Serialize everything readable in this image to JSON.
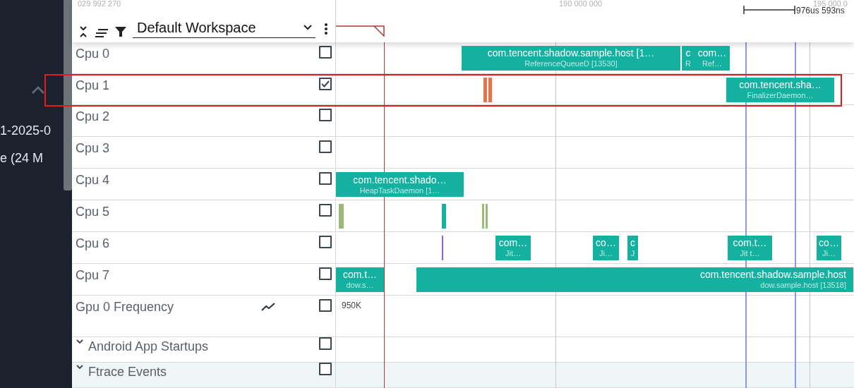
{
  "sidebar": {
    "texts": [
      "1-2025-0",
      "e (24 M"
    ]
  },
  "timeline_header": {
    "ticks": [
      "029 992 270",
      "190 000 000",
      "195 000 0"
    ],
    "span": "976us 593ns"
  },
  "toolbar": {
    "workspace": "Default Workspace"
  },
  "tracks": [
    {
      "name": "Cpu 0",
      "kind": "cpu",
      "checked": false,
      "slices": [
        {
          "kind": "slice",
          "title": "com.tencent.shadow.sample.host [1…",
          "subtitle": "ReferenceQueueD [13530]"
        },
        {
          "kind": "slice",
          "title": "c",
          "subtitle": "R"
        },
        {
          "kind": "slice",
          "title": "com…",
          "subtitle": "Ref…"
        }
      ]
    },
    {
      "name": "Cpu 1",
      "kind": "cpu",
      "checked": true,
      "highlighted": true,
      "slices": [
        {
          "kind": "bar",
          "color": "#e8734a"
        },
        {
          "kind": "bar",
          "color": "#e8734a"
        },
        {
          "kind": "slice",
          "title": "com.tencent.sha…",
          "subtitle": "FinalizerDaemon…"
        }
      ]
    },
    {
      "name": "Cpu 2",
      "kind": "cpu",
      "checked": false
    },
    {
      "name": "Cpu 3",
      "kind": "cpu",
      "checked": false
    },
    {
      "name": "Cpu 4",
      "kind": "cpu",
      "checked": false,
      "slices": [
        {
          "kind": "slice",
          "title": "com.tencent.shado…",
          "subtitle": "HeapTaskDaemon [1…"
        }
      ]
    },
    {
      "name": "Cpu 5",
      "kind": "cpu",
      "checked": false,
      "slices": [
        {
          "kind": "bar",
          "color": "#9ab878"
        },
        {
          "kind": "bar",
          "color": "#14b0a0"
        },
        {
          "kind": "bar",
          "color": "#9ab878"
        },
        {
          "kind": "bar",
          "color": "#9ab878"
        }
      ]
    },
    {
      "name": "Cpu 6",
      "kind": "cpu",
      "checked": false,
      "slices": [
        {
          "kind": "bar",
          "color": "#a25ccf"
        },
        {
          "kind": "slice",
          "title": "com…",
          "subtitle": "Jit…"
        },
        {
          "kind": "slice",
          "title": "co…",
          "subtitle": "Ji…"
        },
        {
          "kind": "slice",
          "title": "c",
          "subtitle": "J"
        },
        {
          "kind": "slice",
          "title": "com.t…",
          "subtitle": "Jit t…"
        },
        {
          "kind": "slice",
          "title": "co…",
          "subtitle": "Ji…"
        }
      ]
    },
    {
      "name": "Cpu 7",
      "kind": "cpu",
      "checked": false,
      "slices": [
        {
          "kind": "slice",
          "title": "com.t…",
          "subtitle": "dow.s…"
        },
        {
          "kind": "slice",
          "title": "com.tencent.shadow.sample.host",
          "subtitle": "dow.sample.host [13518]"
        }
      ]
    },
    {
      "name": "Gpu 0 Frequency",
      "kind": "counter",
      "checked": false,
      "value_label": "950K"
    },
    {
      "name": "Android App Startups",
      "kind": "group",
      "checked": false,
      "expanded": true
    },
    {
      "name": "Ftrace Events",
      "kind": "group",
      "checked": false,
      "expanded": true
    }
  ]
}
